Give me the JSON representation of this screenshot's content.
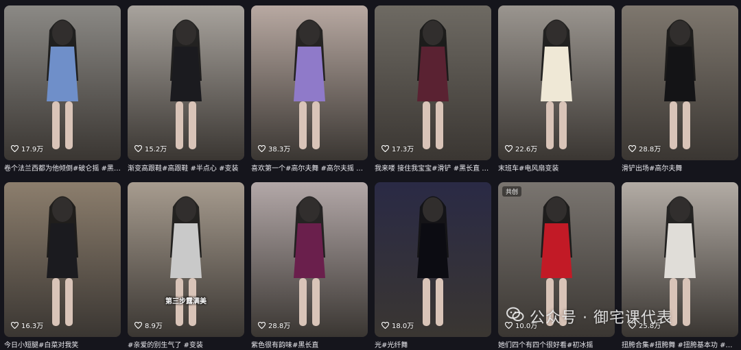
{
  "feed": {
    "videos": [
      {
        "likes": "17.9万",
        "caption": "卷个法兰西都为他倾倒#破仑摇 #黑…",
        "bg": "#8b8985",
        "accent": "#6f8fc9"
      },
      {
        "likes": "15.2万",
        "caption": "渐变高跟鞋#高跟鞋 #半点心 #变装",
        "bg": "#a8a39d",
        "accent": "#1b1b1f"
      },
      {
        "likes": "38.3万",
        "caption": "喜欢第一个#高尔夫舞 #高尔夫摇 #…",
        "bg": "#b8a9a2",
        "accent": "#8f7ac9"
      },
      {
        "likes": "17.3万",
        "caption": "我来喽 接住我宝宝#滑铲 #黑长直 #…",
        "bg": "#6e6a63",
        "accent": "#5a2232"
      },
      {
        "likes": "22.6万",
        "caption": "末班车#电风扇变装",
        "bg": "#9a958f",
        "accent": "#efe8d6"
      },
      {
        "likes": "28.8万",
        "caption": "滑铲出场#高尔夫舞",
        "bg": "#7e776e",
        "accent": "#141416"
      },
      {
        "likes": "16.3万",
        "caption": "今日小短腿#白菜对我笑",
        "bg": "#8c7e6d",
        "accent": "#1b1b1f"
      },
      {
        "likes": "8.9万",
        "caption": "#亲爱的别生气了 #变装",
        "bg": "#a79c8f",
        "accent": "#c9c9c9",
        "overlay": "第三步露满美"
      },
      {
        "likes": "28.8万",
        "caption": "紫色很有韵味#黑长直",
        "bg": "#b3a8a8",
        "accent": "#6a1f4c"
      },
      {
        "likes": "18.0万",
        "caption": "光#光纤舞",
        "bg": "#2a2a45",
        "accent": "#0c0c12"
      },
      {
        "likes": "10.0万",
        "caption": "她们四个有四个很好看#初冰摇",
        "bg": "#7a7570",
        "accent": "#c21a26",
        "badge": "共创"
      },
      {
        "likes": "25.8万",
        "caption": "扭胯合集#扭胯舞 #扭胯基本功 #扭…",
        "bg": "#b3aca5",
        "accent": "#e0ddd8"
      }
    ]
  },
  "watermark": {
    "text": "公众号 · 御宅课代表",
    "icon": "wechat-icon"
  }
}
